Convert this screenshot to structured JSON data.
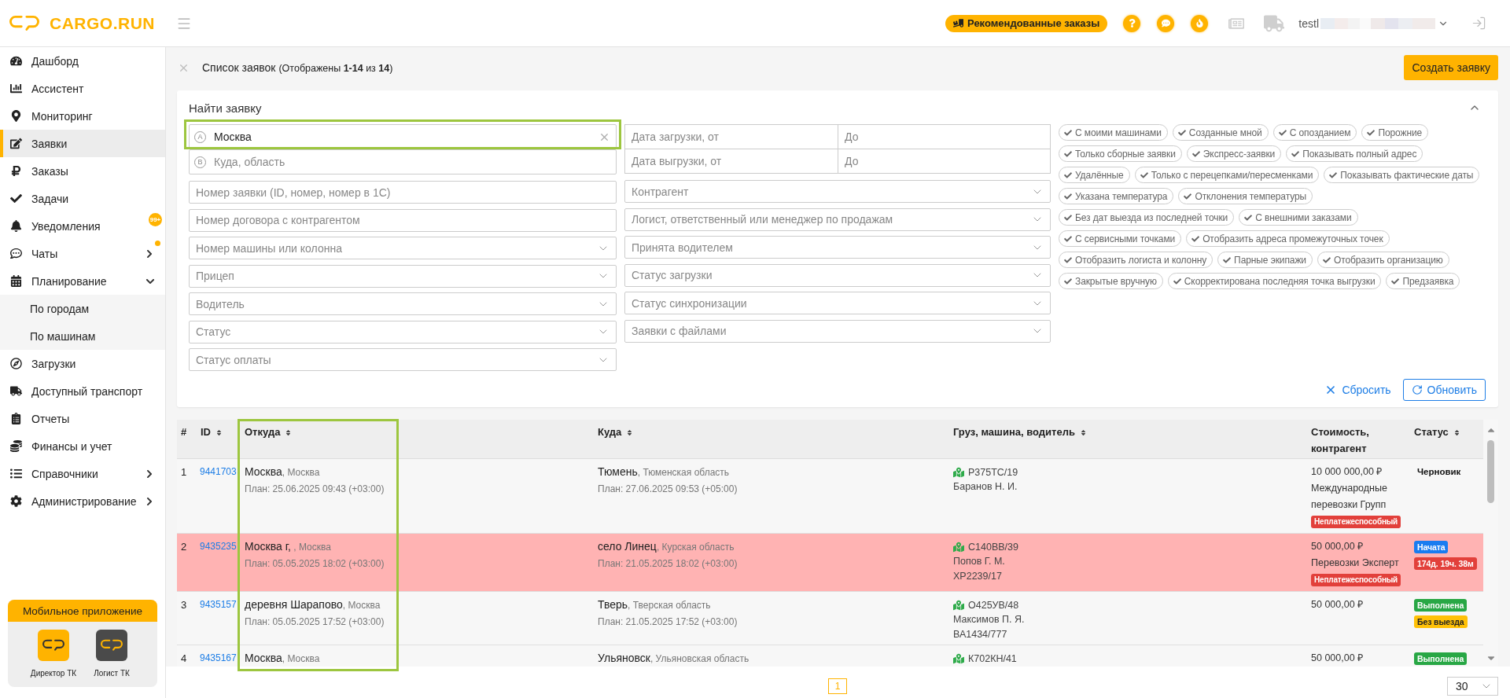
{
  "header": {
    "logo": "CARGO.RUN",
    "promo_button": "Рекомендованные заказы",
    "user": "testl"
  },
  "sidebar": {
    "items": [
      {
        "label": "Дашборд",
        "selected": false
      },
      {
        "label": "Ассистент",
        "selected": false
      },
      {
        "label": "Мониторинг",
        "selected": false
      },
      {
        "label": "Заявки",
        "selected": true
      },
      {
        "label": "Заказы",
        "selected": false
      },
      {
        "label": "Задачи",
        "selected": false
      },
      {
        "label": "Уведомления",
        "selected": false,
        "badge": "99+"
      },
      {
        "label": "Чаты",
        "selected": false,
        "dot": true,
        "expanded": false
      },
      {
        "label": "Планирование",
        "selected": false,
        "expanded": true,
        "children": [
          {
            "label": "По городам",
            "selected": false
          },
          {
            "label": "По машинам",
            "selected": false
          }
        ]
      },
      {
        "label": "Загрузки",
        "selected": false
      },
      {
        "label": "Доступный транспорт",
        "selected": false
      },
      {
        "label": "Отчеты",
        "selected": false
      },
      {
        "label": "Финансы и учет",
        "selected": false
      },
      {
        "label": "Справочники",
        "selected": false,
        "expanded": false
      },
      {
        "label": "Администрирование",
        "selected": false,
        "expanded": false
      }
    ],
    "mobile_app": {
      "title": "Мобильное приложение",
      "apps": [
        {
          "label": "Директор ТК",
          "color": "#ffb300"
        },
        {
          "label": "Логист ТК",
          "color": "#4a4a4a"
        }
      ]
    }
  },
  "page": {
    "title": "Список заявок",
    "subtitle": "(Отображены **1-14** из **14**)",
    "create_button": "Создать заявку"
  },
  "filters": {
    "title": "Найти заявку",
    "expanded": true,
    "route": [
      {
        "marker": "A",
        "value": "Москва",
        "highlighted": true
      },
      {
        "marker": "B",
        "placeholder": "Куда, область",
        "highlighted": false
      }
    ],
    "dates": [
      {
        "from_placeholder": "Дата загрузки, от",
        "to_placeholder": "До"
      },
      {
        "from_placeholder": "Дата выгрузки, от",
        "to_placeholder": "До"
      }
    ],
    "left_fields": [
      {
        "kind": "input",
        "placeholder": "Номер заявки (ID, номер, номер в 1С)"
      },
      {
        "kind": "input",
        "placeholder": "Номер договора с контрагентом"
      },
      {
        "kind": "select",
        "placeholder": "Номер машины или колонна"
      },
      {
        "kind": "select",
        "placeholder": "Прицеп"
      },
      {
        "kind": "select",
        "placeholder": "Водитель"
      },
      {
        "kind": "select",
        "placeholder": "Статус"
      },
      {
        "kind": "select",
        "placeholder": "Статус оплаты"
      }
    ],
    "right_fields": [
      {
        "kind": "select",
        "placeholder": "Контрагент"
      },
      {
        "kind": "select",
        "placeholder": "Логист, ответственный или менеджер по продажам"
      },
      {
        "kind": "select",
        "placeholder": "Принята водителем"
      },
      {
        "kind": "select",
        "placeholder": "Статус загрузки"
      },
      {
        "kind": "select",
        "placeholder": "Статус синхронизации"
      },
      {
        "kind": "select",
        "placeholder": "Заявки с файлами"
      }
    ],
    "toggles": [
      "С моими машинами",
      "Созданные мной",
      "С опозданием",
      "Порожние",
      "Только сборные заявки",
      "Экспресс-заявки",
      "Показывать полный адрес",
      "Удалённые",
      "Только с перецепками/пересменками",
      "Показывать фактические даты",
      "Указана температура",
      "Отклонения температуры",
      "Без дат выезда из последней точки",
      "С внешними заказами",
      "С сервисными точками",
      "Отобразить адреса промежуточных точек",
      "Отобразить логиста и колонну",
      "Парные экипажи",
      "Отобразить организацию",
      "Закрытые вручную",
      "Скорректирована последняя точка выгрузки",
      "Предзаявка"
    ],
    "reset": "Сбросить",
    "refresh": "Обновить"
  },
  "table": {
    "columns": [
      {
        "label": "#",
        "sortable": false,
        "highlighted": false
      },
      {
        "label": "ID",
        "sortable": true,
        "highlighted": false
      },
      {
        "label": "Откуда",
        "sortable": true,
        "highlighted": true
      },
      {
        "label": "Куда",
        "sortable": true,
        "highlighted": false
      },
      {
        "label": "Груз, машина, водитель",
        "sortable": true,
        "highlighted": false
      },
      {
        "label": "Стоимость, контрагент",
        "sortable": false,
        "highlighted": false
      },
      {
        "label": "Статус",
        "sortable": true,
        "highlighted": false
      }
    ],
    "rows": [
      {
        "number": "1",
        "id": "9441703",
        "flagged": false,
        "from": {
          "city": "Москва",
          "region": ", Москва",
          "plan": "План: 25.06.2025 09:43 (+03:00)"
        },
        "to": {
          "city": "Тюмень",
          "region": ", Тюменская область",
          "plan": "План: 27.06.2025 09:53 (+05:00)"
        },
        "cargo": {
          "vehicle": "Р375ТС/19",
          "lines": [
            "Баранов Н. И."
          ]
        },
        "cost": {
          "amount": "10 000 000,00 ₽",
          "counterparty": "Международные перевозки Групп",
          "warning": "Неплатежеспособный"
        },
        "status": [
          {
            "kind": "plain",
            "text": "Черновик"
          }
        ]
      },
      {
        "number": "2",
        "id": "9435235",
        "flagged": true,
        "from": {
          "city": "Москва г,",
          "region": " , Москва",
          "plan": "План: 05.05.2025 18:02 (+03:00)"
        },
        "to": {
          "city": "село Линец",
          "region": ", Курская область",
          "plan": "План: 21.05.2025 18:02 (+03:00)"
        },
        "cargo": {
          "vehicle": "С140ВВ/39",
          "lines": [
            "Попов Г. М.",
            "ХР2239/17"
          ]
        },
        "cost": {
          "amount": "50 000,00 ₽",
          "counterparty": "Перевозки Эксперт",
          "warning": "Неплатежеспособный"
        },
        "status": [
          {
            "kind": "badge",
            "text": "Начата",
            "color": "#1a7cf0"
          },
          {
            "kind": "badge",
            "text": "174д. 19ч. 38м",
            "color": "#e2403b"
          }
        ]
      },
      {
        "number": "3",
        "id": "9435157",
        "flagged": false,
        "from": {
          "city": "деревня Шарапово",
          "region": ", Москва",
          "plan": "План: 05.05.2025 17:52 (+03:00)"
        },
        "to": {
          "city": "Тверь",
          "region": ", Тверская область",
          "plan": "План: 21.05.2025 17:52 (+03:00)"
        },
        "cargo": {
          "vehicle": "О425УВ/48",
          "lines": [
            "Максимов П. Я.",
            "ВА1434/777"
          ]
        },
        "cost": {
          "amount": "50 000,00 ₽"
        },
        "status": [
          {
            "kind": "badge",
            "text": "Выполнена",
            "color": "#28a745"
          },
          {
            "kind": "badge",
            "text": "Без выезда",
            "color": "#ffc107"
          }
        ]
      },
      {
        "number": "4",
        "id": "9435167",
        "flagged": false,
        "from": {
          "city": "Москва",
          "region": ", Москва"
        },
        "to": {
          "city": "Ульяновск",
          "region": ", Ульяновская область"
        },
        "cargo": {
          "vehicle": "К702КН/41"
        },
        "cost": {
          "amount": "50 000,00 ₽"
        },
        "status": [
          {
            "kind": "badge",
            "text": "Выполнена",
            "color": "#28a745"
          }
        ]
      }
    ]
  },
  "pagination": {
    "pages": [
      {
        "label": "1",
        "selected": true
      }
    ],
    "page_size": "30"
  }
}
